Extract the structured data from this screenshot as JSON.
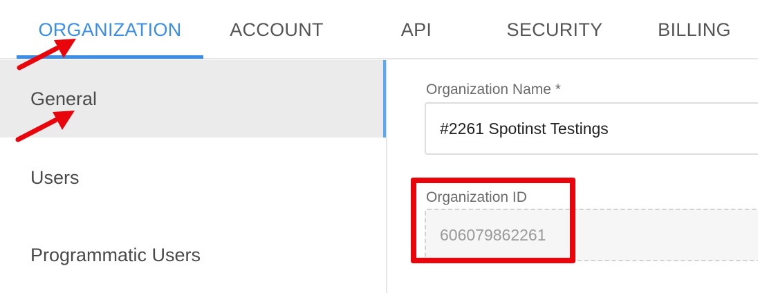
{
  "tabs": [
    {
      "label": "ORGANIZATION",
      "active": true
    },
    {
      "label": "ACCOUNT",
      "active": false
    },
    {
      "label": "API",
      "active": false
    },
    {
      "label": "SECURITY",
      "active": false
    },
    {
      "label": "BILLING",
      "active": false
    }
  ],
  "sidebar": {
    "items": [
      {
        "label": "General",
        "active": true
      },
      {
        "label": "Users",
        "active": false
      },
      {
        "label": "Programmatic Users",
        "active": false
      }
    ]
  },
  "form": {
    "org_name_label": "Organization Name *",
    "org_name_value": "#2261 Spotinst Testings",
    "org_id_label": "Organization ID",
    "org_id_value": "606079862261"
  },
  "colors": {
    "accent": "#3b8ee8",
    "annotation": "#e8050b"
  }
}
